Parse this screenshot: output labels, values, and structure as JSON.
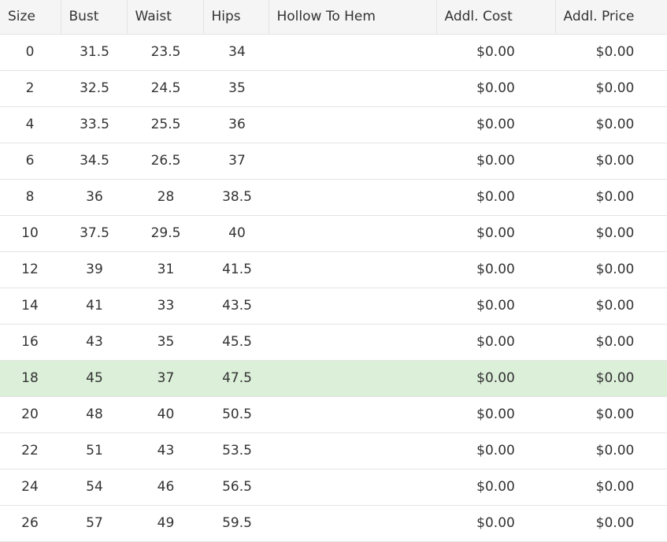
{
  "table": {
    "columns": [
      "Size",
      "Bust",
      "Waist",
      "Hips",
      "Hollow To Hem",
      "Addl. Cost",
      "Addl. Price"
    ],
    "highlight_color": "#dcefd9",
    "header_bg": "#f5f5f5",
    "rows": [
      [
        "0",
        "31.5",
        "23.5",
        "34",
        "",
        "$0.00",
        "$0.00"
      ],
      [
        "2",
        "32.5",
        "24.5",
        "35",
        "",
        "$0.00",
        "$0.00"
      ],
      [
        "4",
        "33.5",
        "25.5",
        "36",
        "",
        "$0.00",
        "$0.00"
      ],
      [
        "6",
        "34.5",
        "26.5",
        "37",
        "",
        "$0.00",
        "$0.00"
      ],
      [
        "8",
        "36",
        "28",
        "38.5",
        "",
        "$0.00",
        "$0.00"
      ],
      [
        "10",
        "37.5",
        "29.5",
        "40",
        "",
        "$0.00",
        "$0.00"
      ],
      [
        "12",
        "39",
        "31",
        "41.5",
        "",
        "$0.00",
        "$0.00"
      ],
      [
        "14",
        "41",
        "33",
        "43.5",
        "",
        "$0.00",
        "$0.00"
      ],
      [
        "16",
        "43",
        "35",
        "45.5",
        "",
        "$0.00",
        "$0.00"
      ],
      [
        "18",
        "45",
        "37",
        "47.5",
        "",
        "$0.00",
        "$0.00"
      ],
      [
        "20",
        "48",
        "40",
        "50.5",
        "",
        "$0.00",
        "$0.00"
      ],
      [
        "22",
        "51",
        "43",
        "53.5",
        "",
        "$0.00",
        "$0.00"
      ],
      [
        "24",
        "54",
        "46",
        "56.5",
        "",
        "$0.00",
        "$0.00"
      ],
      [
        "26",
        "57",
        "49",
        "59.5",
        "",
        "$0.00",
        "$0.00"
      ]
    ],
    "highlighted_size": "18"
  }
}
